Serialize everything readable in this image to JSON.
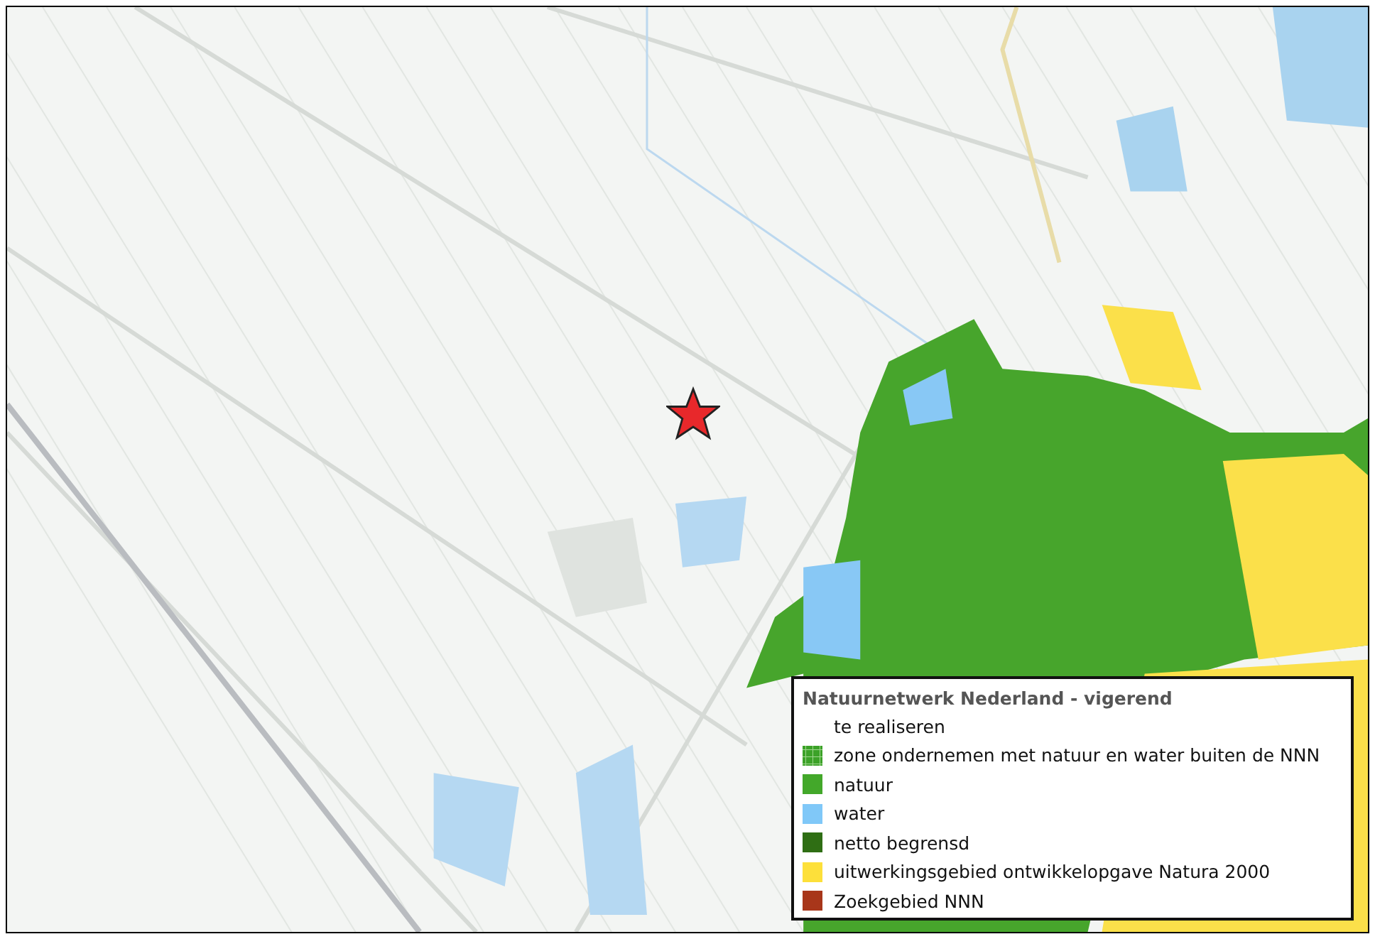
{
  "map": {
    "marker": {
      "kind": "star"
    }
  },
  "legend": {
    "title": "Natuurnetwerk Nederland - vigerend",
    "items": [
      {
        "label": "te realiseren",
        "kind": "blank"
      },
      {
        "label": "zone ondernemen met natuur en water buiten de NNN",
        "kind": "hatched",
        "color": "#3ca228"
      },
      {
        "label": "natuur",
        "kind": "solid",
        "color": "#43a82a"
      },
      {
        "label": "water",
        "kind": "solid",
        "color": "#80c8f8"
      },
      {
        "label": "netto begrensd",
        "kind": "solid",
        "color": "#2f6e14"
      },
      {
        "label": "uitwerkingsgebied ontwikkelopgave Natura 2000",
        "kind": "solid",
        "color": "#fde03a"
      },
      {
        "label": "Zoekgebied NNN",
        "kind": "solid",
        "color": "#a8361a"
      }
    ]
  }
}
